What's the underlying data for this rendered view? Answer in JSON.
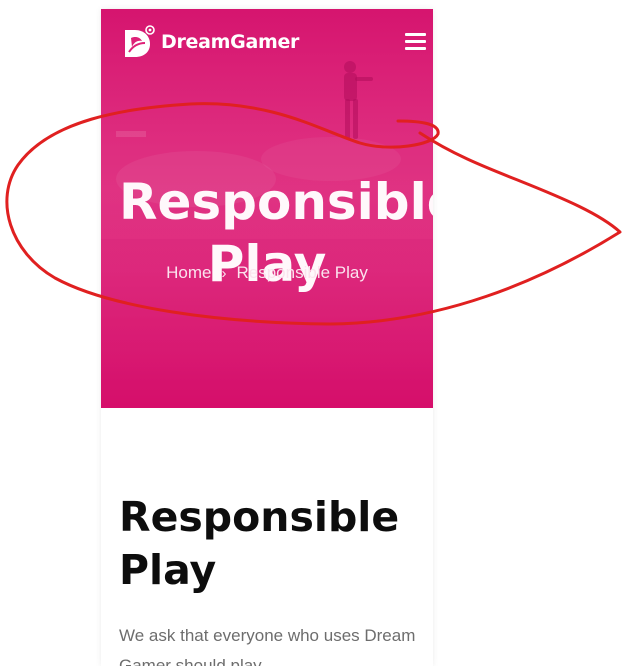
{
  "header": {
    "brand_name": "DreamGamer",
    "logo_icon": "dreamgamer-logo-icon",
    "menu_icon": "hamburger-menu-icon"
  },
  "hero": {
    "title_line1": "Responsible",
    "title_line2": "Play",
    "background_color": "#dc2077",
    "breadcrumb": {
      "home": "Home",
      "separator_icon": "chevron-right-icon",
      "current": "Responsible Play"
    }
  },
  "content": {
    "title": "Responsible Play",
    "intro_text": "We ask that everyone who uses Dream Gamer should play"
  },
  "annotation": {
    "color": "#e02020",
    "shape": "hand-drawn-ellipse"
  }
}
